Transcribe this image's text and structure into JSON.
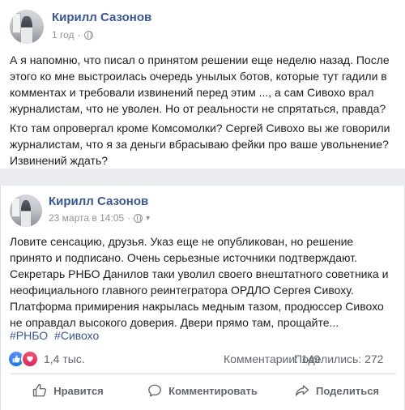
{
  "post1": {
    "author": "Кирилл Сазонов",
    "time": "1 год",
    "paragraphs": [
      "А я напомню, что писал о принятом решении еще неделю назад. После этого ко мне выстроилась очередь унылых ботов, которые тут гадили в комментах и требовали извинений перед этим ..., а сам Сивохо врал журналистам, что не уволен. Но от реальности не спрятаться, правда?",
      "Кто там опровергал кроме Комсомолки? Сергей Сивохо вы же говорили журналистам, что я за деньги вбрасываю фейки про ваше увольнение? Извинений ждать?"
    ]
  },
  "post2": {
    "author": "Кирилл Сазонов",
    "time": "23 марта в 14:05",
    "text": "Ловите сенсацию, друзья. Указ еще не опубликован, но решение принято и подписано. Очень серьезные источники подтверждают. Секретарь РНБО Данилов таки уволил своего внештатного советника и неофициального главного реинтегратора ОРДЛО Сергея Сивоху. Платформа примирения накрылась медным тазом, продюссер Сивохо не оправдал высокого доверия. Двери прямо там, прощайте...",
    "hashtags": [
      "#РНБО",
      "#Сивохо"
    ],
    "reactions_count": "1,4 тыс.",
    "comments": "Комментарии: 149",
    "shares": "Поделились: 272",
    "actions": {
      "like": "Нравится",
      "comment": "Комментировать",
      "share": "Поделиться"
    }
  },
  "icons": {
    "reaction_like": "thumbs-up-icon",
    "reaction_love": "heart-icon",
    "privacy": "globe-icon",
    "dropdown": "chevron-down-icon"
  },
  "colors": {
    "author": "#365899",
    "hashtag": "#365899",
    "meta": "#90949c",
    "like": "#1877f2",
    "love": "#e0245e",
    "feed_bg": "#e9ebee"
  }
}
